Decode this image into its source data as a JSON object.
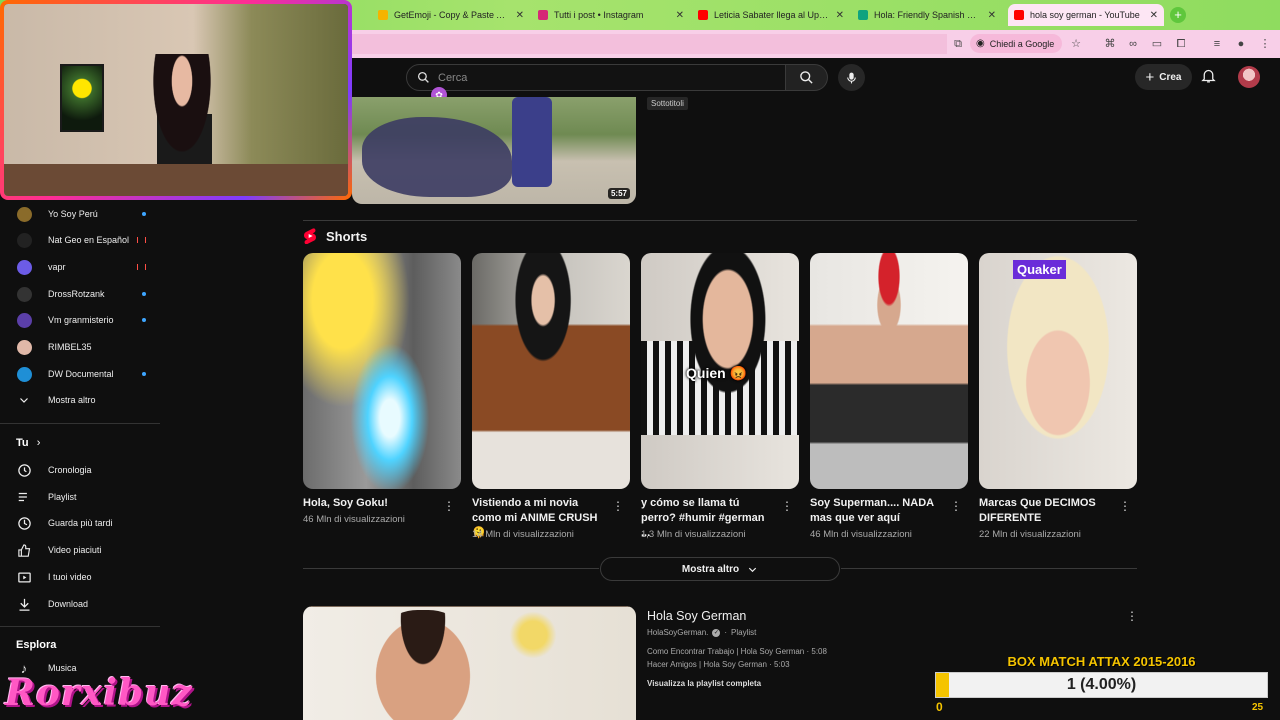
{
  "browser": {
    "tabs": [
      {
        "title": "GetEmoji - Copy & Paste All E",
        "favicon_color": "#f5b400"
      },
      {
        "title": "Tutti i post • Instagram",
        "favicon_color": "#d62976"
      },
      {
        "title": "Leticia Sabater llega al Upsid",
        "favicon_color": "#ff0000"
      },
      {
        "title": "Hola: Friendly Spanish Greeti",
        "favicon_color": "#10a37f"
      },
      {
        "title": "hola soy german - YouTube",
        "favicon_color": "#ff0000"
      }
    ],
    "ask_google": "Chiedi a Google"
  },
  "header": {
    "search_placeholder": "Cerca",
    "create_label": "Crea"
  },
  "top_video": {
    "duration": "5:57",
    "subtitles_chip": "Sottotitoli"
  },
  "sidebar": {
    "subscriptions": [
      {
        "name": "Yo Soy Perú",
        "indicator": "new",
        "color": "#8a6b2a"
      },
      {
        "name": "Nat Geo en Español",
        "indicator": "live",
        "color": "#222222"
      },
      {
        "name": "vapr",
        "indicator": "live",
        "color": "#6c5ce7"
      },
      {
        "name": "DrossRotzank",
        "indicator": "new",
        "color": "#333333"
      },
      {
        "name": "Vm granmisterio",
        "indicator": "new",
        "color": "#5b3fa8"
      },
      {
        "name": "RIMBEL35",
        "indicator": "",
        "color": "#e0b8a8"
      },
      {
        "name": "DW Documental",
        "indicator": "new",
        "color": "#1f8fd6"
      }
    ],
    "show_more": "Mostra altro",
    "you_heading": "Tu",
    "you_items": [
      "Cronologia",
      "Playlist",
      "Guarda più tardi",
      "Video piaciuti",
      "I tuoi video",
      "Download"
    ],
    "explore_heading": "Esplora",
    "explore_items": [
      "Musica"
    ]
  },
  "shorts": {
    "heading": "Shorts",
    "items": [
      {
        "title": "Hola, Soy Goku!",
        "views": "46 Mln di visualizzazioni",
        "overlay": ""
      },
      {
        "title": "Vistiendo a mi novia como mi ANIME CRUSH 🫠",
        "views": "14 Mln di visualizzazioni",
        "overlay": ""
      },
      {
        "title": "y cómo se llama tú perro? #humir #german ...",
        "views": "1,3 Mln di visualizzazioni",
        "overlay": "Quien 😡"
      },
      {
        "title": "Soy Superman.... NADA mas que ver aquí",
        "views": "46 Mln di visualizzazioni",
        "overlay": ""
      },
      {
        "title": "Marcas Que DECIMOS DIFERENTE",
        "views": "22 Mln di visualizzazioni",
        "overlay": "Quaker"
      }
    ],
    "show_more": "Mostra altro"
  },
  "playlist": {
    "title": "Hola Soy German",
    "channel": "HolaSoyGerman.",
    "type": "Playlist",
    "videos": [
      "Como Encontrar Trabajo | Hola Soy German · 5:08",
      "Hacer Amigos | Hola Soy German · 5:03"
    ],
    "view_full": "Visualizza la playlist completa"
  },
  "stream_overlay": {
    "brand": "Rorxibuz",
    "goal_title": "BOX MATCH ATTAX 2015-2016",
    "goal_label": "1 (4.00%)",
    "goal_progress": 0.04,
    "goal_min": "0",
    "goal_max": "25"
  }
}
